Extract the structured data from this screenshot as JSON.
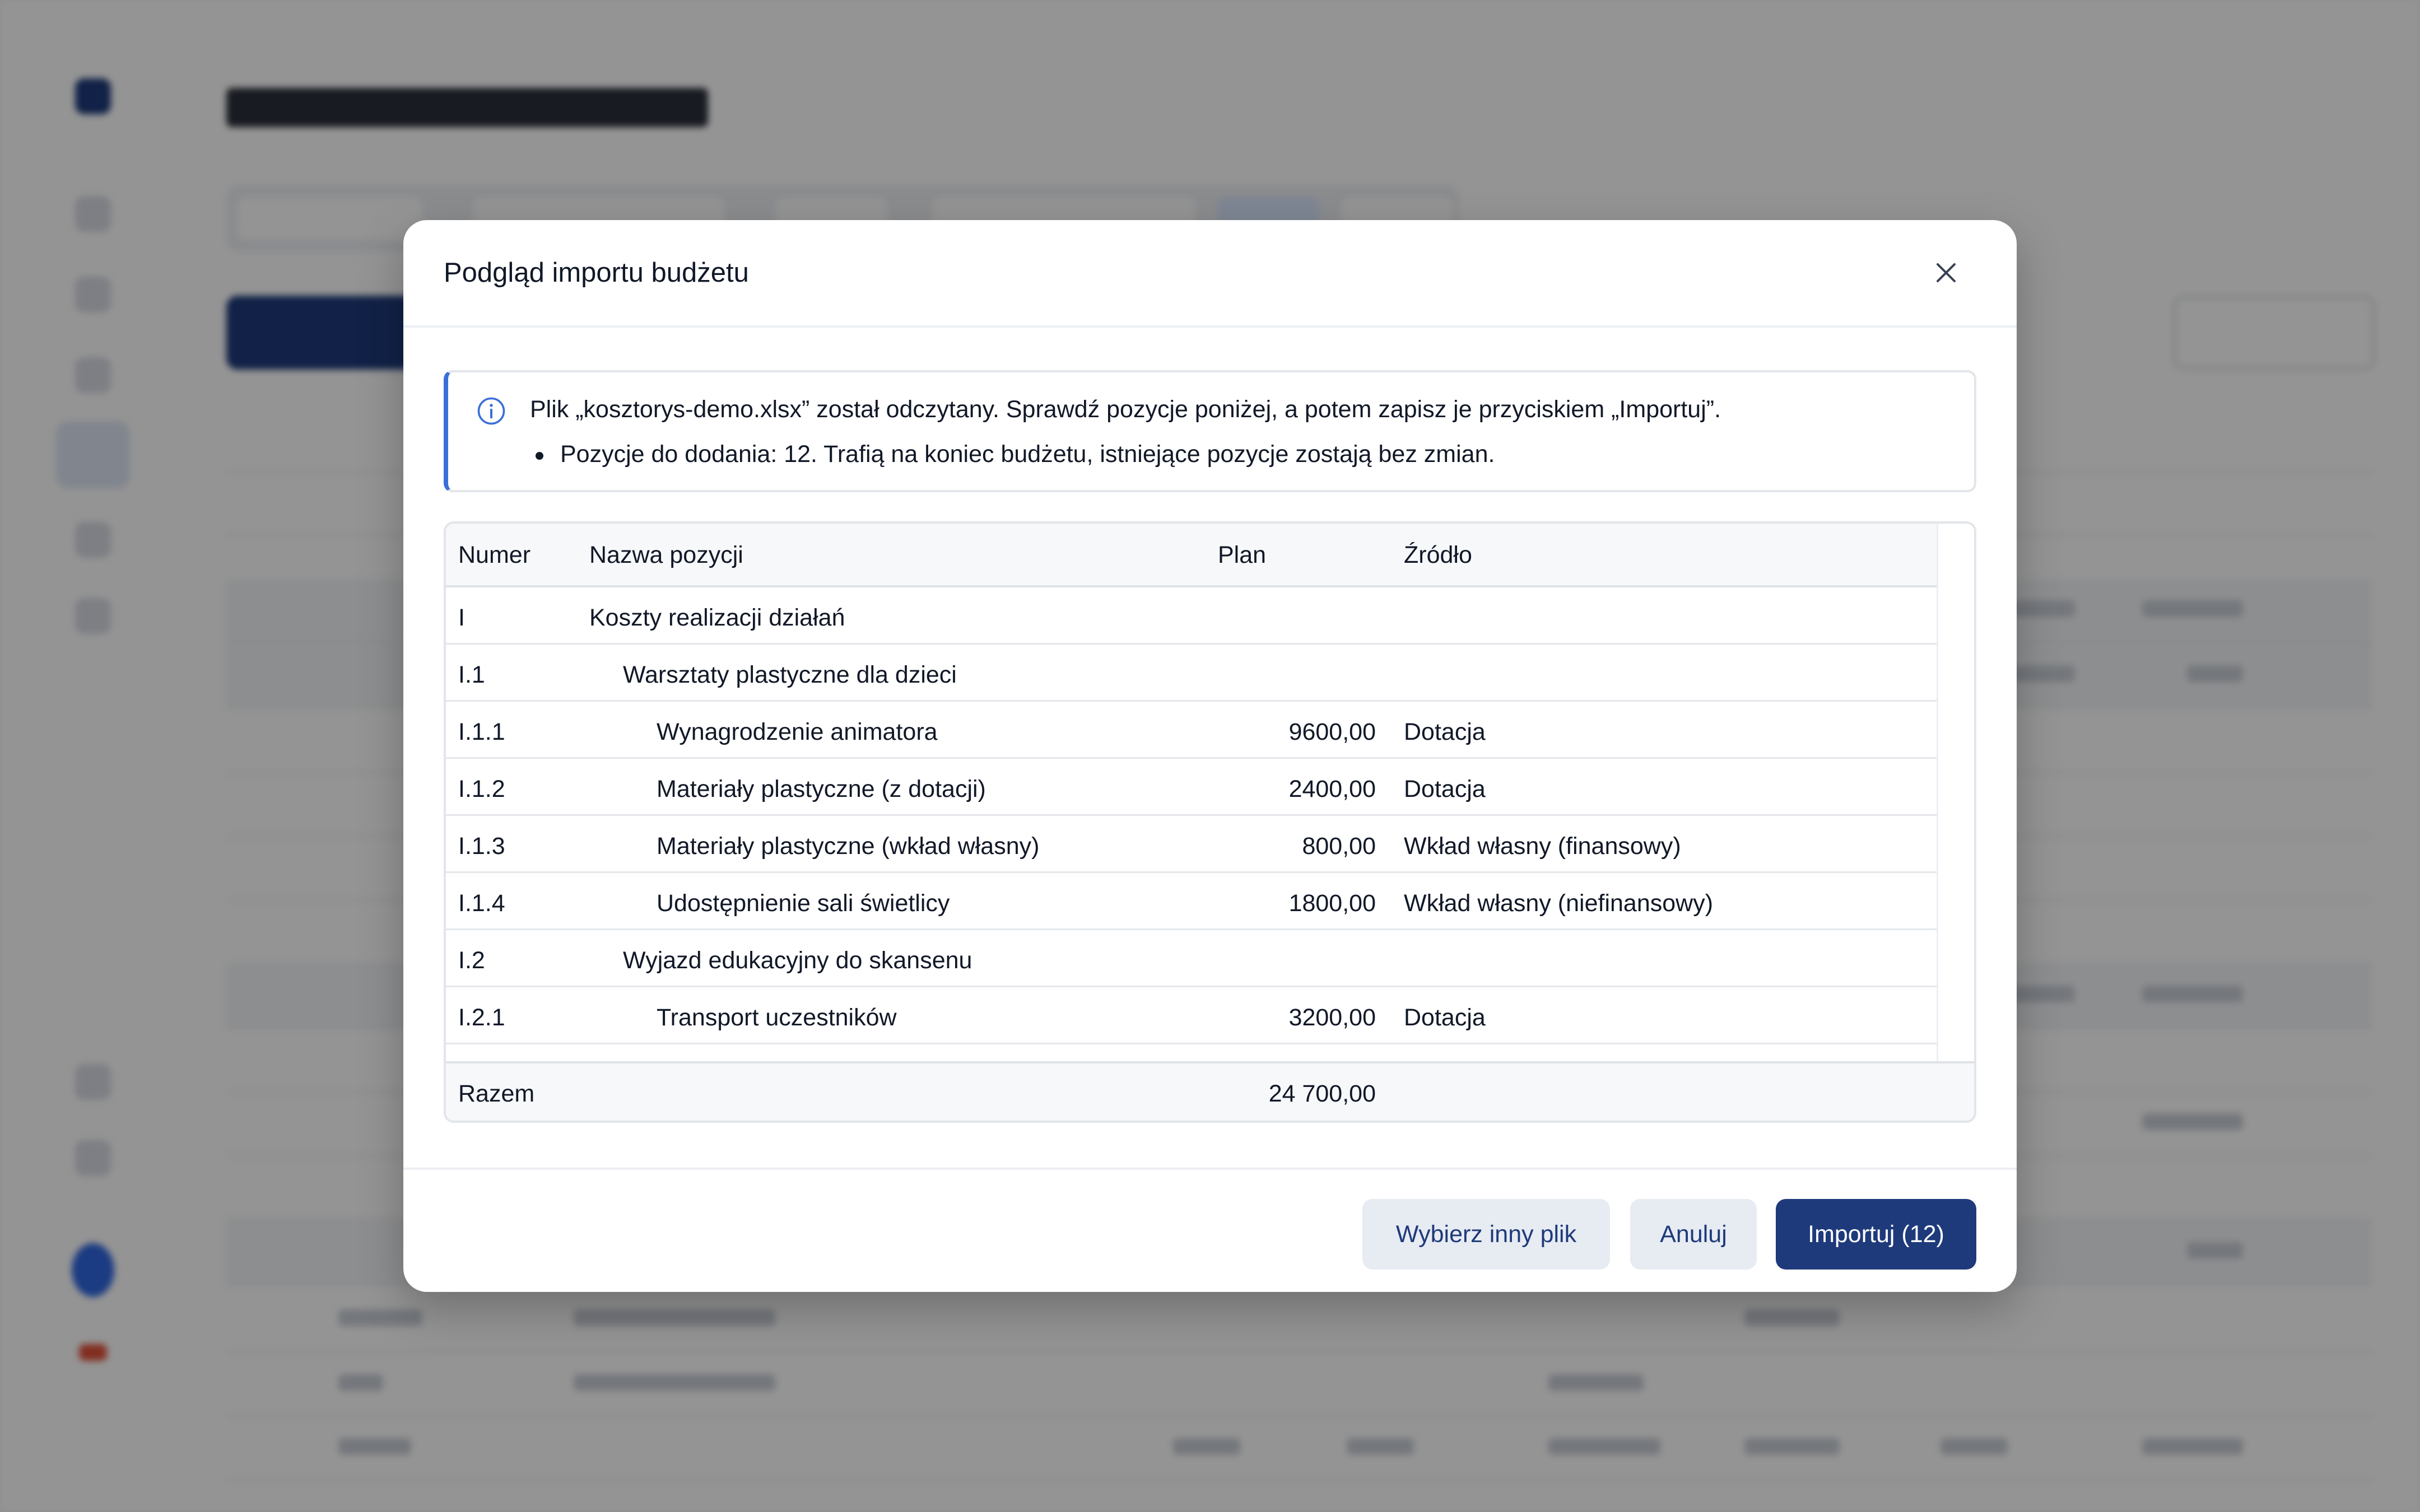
{
  "modal": {
    "title": "Podgląd importu budżetu",
    "info": {
      "message": "Plik „kosztorys-demo.xlsx” został odczytany. Sprawdź pozycje poniżej, a potem zapisz je przyciskiem „Importuj”.",
      "bullet": "Pozycje do dodania: 12. Trafią na koniec budżetu, istniejące pozycje zostają bez zmian."
    },
    "table": {
      "columns": [
        "Numer",
        "Nazwa pozycji",
        "Plan",
        "Źródło"
      ],
      "rows": [
        {
          "number": "I",
          "name": "Koszty realizacji działań",
          "plan": "",
          "source": "",
          "level": 0
        },
        {
          "number": "I.1",
          "name": "Warsztaty plastyczne dla dzieci",
          "plan": "",
          "source": "",
          "level": 1
        },
        {
          "number": "I.1.1",
          "name": "Wynagrodzenie animatora",
          "plan": "9600,00",
          "source": "Dotacja",
          "level": 2
        },
        {
          "number": "I.1.2",
          "name": "Materiały plastyczne (z dotacji)",
          "plan": "2400,00",
          "source": "Dotacja",
          "level": 2
        },
        {
          "number": "I.1.3",
          "name": "Materiały plastyczne (wkład własny)",
          "plan": "800,00",
          "source": "Wkład własny (finansowy)",
          "level": 2
        },
        {
          "number": "I.1.4",
          "name": "Udostępnienie sali świetlicy",
          "plan": "1800,00",
          "source": "Wkład własny (niefinansowy)",
          "level": 2
        },
        {
          "number": "I.2",
          "name": "Wyjazd edukacyjny do skansenu",
          "plan": "",
          "source": "",
          "level": 1
        },
        {
          "number": "I.2.1",
          "name": "Transport uczestników",
          "plan": "3200,00",
          "source": "Dotacja",
          "level": 2
        }
      ],
      "footer": {
        "label": "Razem",
        "total": "24 700,00"
      }
    },
    "buttons": {
      "choose_other": "Wybierz inny plik",
      "cancel": "Anuluj",
      "import": "Importuj (12)"
    }
  },
  "colors": {
    "primary": "#1e3a7b",
    "info_accent": "#3b6fd8",
    "secondary_button": "#e7ebf2"
  },
  "icons": {
    "close": "close-icon",
    "info": "info-icon"
  }
}
